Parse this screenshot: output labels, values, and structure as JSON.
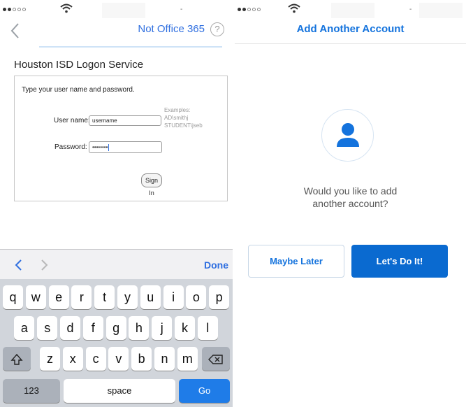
{
  "left": {
    "nav": {
      "title": "Not Office 365",
      "help": "?"
    },
    "form": {
      "title": "Houston ISD Logon Service",
      "prompt": "Type your user name and password.",
      "username_label": "User name:",
      "username_value": "username",
      "password_label": "Password:",
      "password_value": "••••••••",
      "examples": [
        "Examples:",
        "AD\\smithj",
        "STUDENT\\jseb"
      ],
      "signin_label": "Sign In"
    },
    "keyboard": {
      "done_label": "Done",
      "row1": [
        "q",
        "w",
        "e",
        "r",
        "t",
        "y",
        "u",
        "i",
        "o",
        "p"
      ],
      "row2": [
        "a",
        "s",
        "d",
        "f",
        "g",
        "h",
        "j",
        "k",
        "l"
      ],
      "row3": [
        "z",
        "x",
        "c",
        "v",
        "b",
        "n",
        "m"
      ],
      "numbers_label": "123",
      "space_label": "space",
      "go_label": "Go"
    }
  },
  "right": {
    "title": "Add Another Account",
    "question_line1": "Would you like to add",
    "question_line2": "another account?",
    "maybe_later_label": "Maybe Later",
    "lets_do_it_label": "Let's Do It!"
  },
  "colors": {
    "accent": "#1473dd",
    "primary_button": "#0a6ad0",
    "keyboard_bg": "#d1d5db"
  }
}
